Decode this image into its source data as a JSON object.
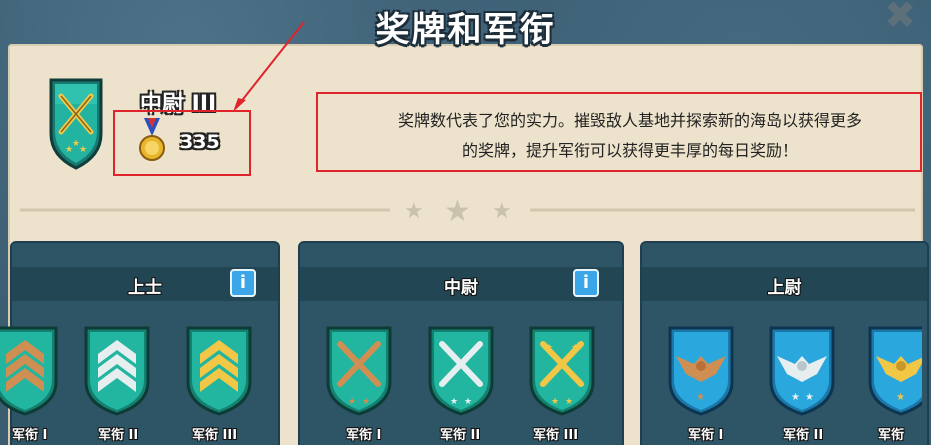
{
  "dialog": {
    "title": "奖牌和军衔",
    "close_icon": "close-icon"
  },
  "player": {
    "rank_name": "中尉 III",
    "medal_count": "335",
    "rank_icon": "crossed-rifles-badge-icon",
    "medal_icon": "medal-icon"
  },
  "description": {
    "line1": "奖牌数代表了您的实力。摧毁敌人基地并探索新的海岛以获得更多",
    "line2": "的奖牌，提升军衔可以获得更丰厚的每日奖励！"
  },
  "colors": {
    "highlight_box": "#e0242b",
    "parchment": "#ede3cc",
    "panel": "#2e5566",
    "teal_badge": "#1fae9a",
    "blue_badge": "#2aa8de"
  },
  "ranks": [
    {
      "title": "上士",
      "has_info": true,
      "insignia": [
        {
          "label": "军衔 I",
          "icon": "bronze-chevron-icon"
        },
        {
          "label": "军衔 II",
          "icon": "silver-chevron-icon"
        },
        {
          "label": "军衔 III",
          "icon": "gold-chevron-icon"
        }
      ]
    },
    {
      "title": "中尉",
      "has_info": true,
      "insignia": [
        {
          "label": "军衔 I",
          "icon": "bronze-crossed-rifles-icon"
        },
        {
          "label": "军衔 II",
          "icon": "silver-crossed-rifles-icon"
        },
        {
          "label": "军衔 III",
          "icon": "gold-crossed-rifles-icon"
        }
      ]
    },
    {
      "title": "上尉",
      "has_info": false,
      "insignia": [
        {
          "label": "军衔 I",
          "icon": "bronze-eagle-icon"
        },
        {
          "label": "军衔 II",
          "icon": "silver-eagle-icon"
        },
        {
          "label": "军衔",
          "icon": "gold-eagle-icon"
        }
      ]
    }
  ],
  "info_label": "i"
}
